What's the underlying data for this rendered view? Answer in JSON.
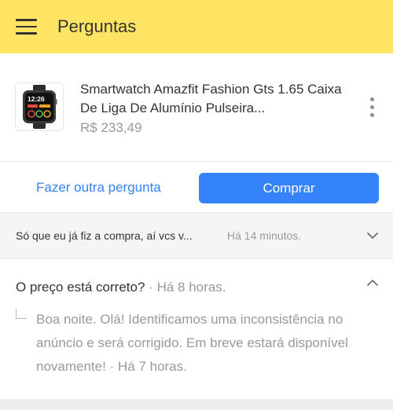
{
  "header": {
    "title": "Perguntas",
    "menu_icon": "hamburger-menu-icon"
  },
  "product": {
    "title": "Smartwatch Amazfit Fashion Gts 1.65 Caixa De Liga De Alumínio Pulseira...",
    "price": "R$ 233,49",
    "thumb_time": "12:26",
    "more_icon": "more-vertical-icon"
  },
  "actions": {
    "ask_again": "Fazer outra pergunta",
    "buy": "Comprar"
  },
  "questions": [
    {
      "text": "Só que eu já fiz a compra, aí vcs v...",
      "time": "Há 14 minutos.",
      "expanded": false
    },
    {
      "text": "O preço está correto?",
      "separator": "·",
      "time": "Há 8 horas.",
      "expanded": true,
      "answer": {
        "text": "Boa noite. Olá! Identificamos uma inconsistência no anúncio e será corrigido. Em breve estará disponível novamente!",
        "separator": "·",
        "time": "Há 7 horas."
      }
    }
  ],
  "colors": {
    "header_bg": "#fee462",
    "accent_blue": "#3483fa",
    "muted_text": "#999999"
  }
}
